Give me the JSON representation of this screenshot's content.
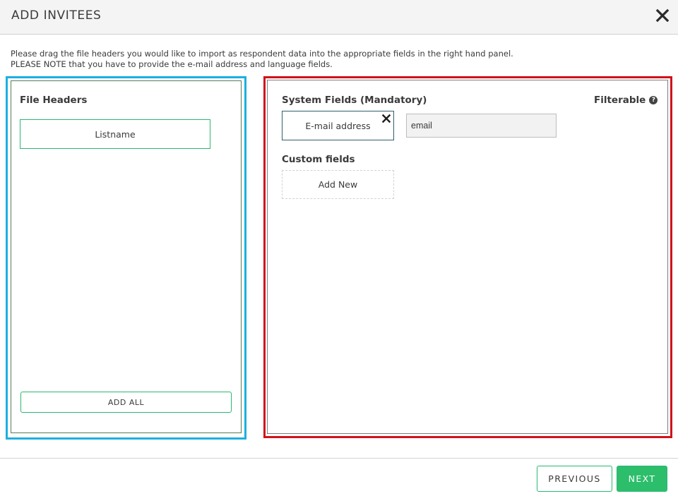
{
  "modal": {
    "title": "ADD INVITEES"
  },
  "instructions": {
    "line1": "Please drag the file headers you would like to import as respondent data into the appropriate fields in the right hand panel.",
    "line2": "PLEASE NOTE that you have to provide the e-mail address and language fields."
  },
  "file_headers": {
    "title": "File Headers",
    "items": [
      {
        "label": "Listname"
      }
    ],
    "add_all_label": "ADD ALL"
  },
  "system_fields": {
    "title": "System Fields (Mandatory)",
    "filterable_label": "Filterable",
    "help_icon": "question-circle-icon",
    "fields": [
      {
        "label": "E-mail address",
        "value": "email"
      }
    ]
  },
  "custom_fields": {
    "title": "Custom fields",
    "add_new_label": "Add New"
  },
  "footer": {
    "previous_label": "PREVIOUS",
    "next_label": "NEXT"
  },
  "colors": {
    "accent_green": "#2dbe6c",
    "highlight_blue": "#1cb0e0",
    "highlight_red": "#d0121b",
    "header_bg": "#f4f4f4"
  }
}
